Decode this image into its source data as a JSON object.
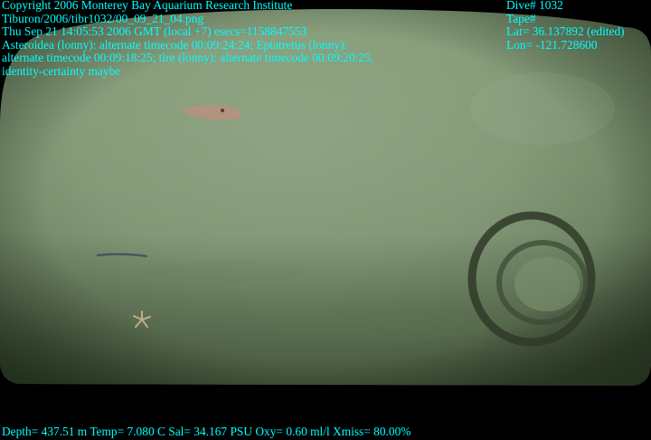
{
  "overlay": {
    "left_lines": [
      "Copyright 2006 Monterey Bay Aquarium Research Institute",
      "Tiburon/2006/tibr1032/00_09_21_04.png",
      "Thu Sep 21 14:05:53 2006 GMT (local +7)  esecs=1158847553",
      "Asteroidea (lonny): alternate timecode 00:09:24:24; Eptatretus (lonny):",
      "alternate timecode 00:09:18:25; tire (lonny): alternate timecode 00:09:20:25,",
      "identity-certainty maybe"
    ],
    "right_lines": [
      "Dive# 1032",
      "Tape#",
      "Lat= 36.137892 (edited)",
      "Lon= -121.728600"
    ],
    "bottom_line": "Depth= 437.51 m  Temp= 7.080 C  Sal= 34.167 PSU  Oxy= 0.60 ml/l  Xmiss= 80.00%"
  },
  "colors": {
    "overlay_text": "#00ffff",
    "seafloor_center": "#8fa584",
    "seafloor_edge": "#56684a",
    "border": "#000000"
  }
}
